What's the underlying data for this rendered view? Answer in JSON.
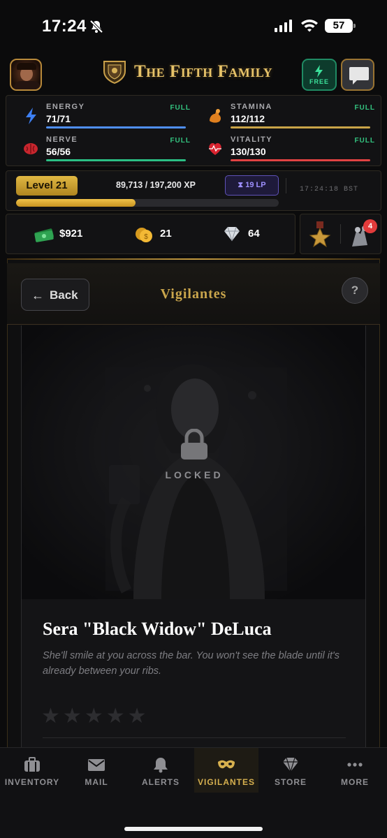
{
  "status_bar": {
    "time": "17:24",
    "battery": "57"
  },
  "header": {
    "title": "The Fifth Family",
    "free_label": "FREE"
  },
  "stats": [
    {
      "name": "ENERGY",
      "value": "71/71",
      "status": "FULL",
      "color": "#4f8ff5"
    },
    {
      "name": "STAMINA",
      "value": "112/112",
      "status": "FULL",
      "color": "#c9a448"
    },
    {
      "name": "NERVE",
      "value": "56/56",
      "status": "FULL",
      "color": "#2bbf84"
    },
    {
      "name": "VITALITY",
      "value": "130/130",
      "status": "FULL",
      "color": "#e04242"
    }
  ],
  "level": {
    "label": "Level 21",
    "xp": "89,713 / 197,200 XP",
    "xp_fraction": 0.455,
    "lp": "19 LP",
    "clock": "17:24:18 BST"
  },
  "currency": {
    "cash": "$921",
    "coins": "21",
    "diamonds": "64"
  },
  "awards": {
    "notification_count": "4"
  },
  "page": {
    "back_label": "Back",
    "title": "Vigilantes",
    "help_label": "?"
  },
  "character": {
    "locked_label": "LOCKED",
    "name": "Sera \"Black Widow\" DeLuca",
    "description": "She'll smile at you across the bar. You won't see the blade until it's already between your ribs.",
    "rating": 0,
    "rating_max": 5
  },
  "tabs": [
    {
      "label": "INVENTORY",
      "icon": "briefcase-icon",
      "active": false
    },
    {
      "label": "MAIL",
      "icon": "envelope-icon",
      "active": false
    },
    {
      "label": "ALERTS",
      "icon": "bell-icon",
      "active": false
    },
    {
      "label": "VIGILANTES",
      "icon": "mask-icon",
      "active": true
    },
    {
      "label": "STORE",
      "icon": "diamond-icon",
      "active": false
    },
    {
      "label": "MORE",
      "icon": "more-dots-icon",
      "active": false
    }
  ],
  "colors": {
    "accent_gold": "#d6b04f",
    "background": "#0b0b0c",
    "free_green": "#3ce19b"
  }
}
